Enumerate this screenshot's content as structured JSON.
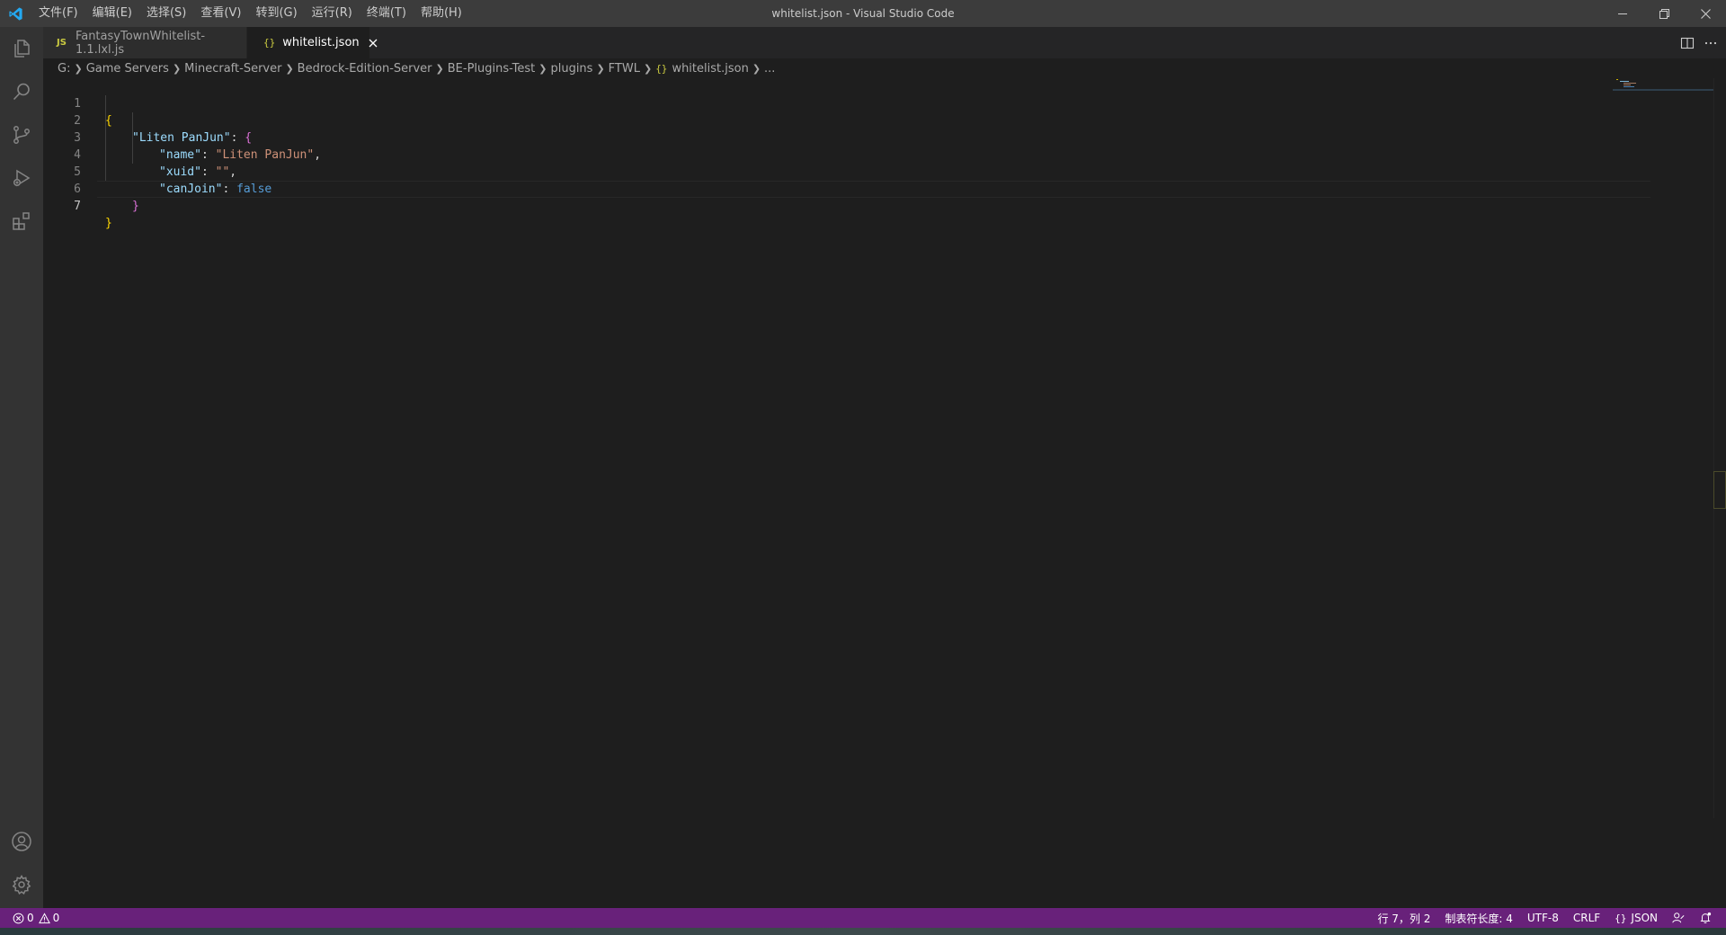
{
  "window": {
    "title": "whitelist.json - Visual Studio Code"
  },
  "menu": [
    "文件(F)",
    "编辑(E)",
    "选择(S)",
    "查看(V)",
    "转到(G)",
    "运行(R)",
    "终端(T)",
    "帮助(H)"
  ],
  "activitybar": {
    "top_icons": [
      "explorer-icon",
      "search-icon",
      "source-control-icon",
      "run-debug-icon",
      "extensions-icon"
    ],
    "bottom_icons": [
      "account-icon",
      "settings-gear-icon"
    ]
  },
  "tabs": [
    {
      "badge": "JS",
      "label": "FantasyTownWhitelist-1.1.lxl.js",
      "active": false
    },
    {
      "badge": "{}",
      "label": "whitelist.json",
      "active": true
    }
  ],
  "breadcrumbs": {
    "items": [
      "G:",
      "Game Servers",
      "Minecraft-Server",
      "Bedrock-Edition-Server",
      "BE-Plugins-Test",
      "plugins",
      "FTWL"
    ],
    "file_icon": "{}",
    "file": "whitelist.json",
    "tail": "..."
  },
  "editor": {
    "line_numbers": [
      "1",
      "2",
      "3",
      "4",
      "5",
      "6",
      "7"
    ],
    "current_line": 7,
    "code": {
      "l1_open": "{",
      "l2_key": "\"Liten PanJun\"",
      "l2_colon": ": ",
      "l2_open": "{",
      "l3_key": "\"name\"",
      "l3_colon": ": ",
      "l3_val": "\"Liten PanJun\"",
      "l3_comma": ",",
      "l4_key": "\"xuid\"",
      "l4_colon": ": ",
      "l4_val": "\"\"",
      "l4_comma": ",",
      "l5_key": "\"canJoin\"",
      "l5_colon": ": ",
      "l5_val": "false",
      "l6_close": "}",
      "l7_close": "}"
    }
  },
  "statusbar": {
    "errors": "0",
    "warnings": "0",
    "position": "行 7，列 2",
    "tab_size": "制表符长度: 4",
    "encoding": "UTF-8",
    "eol": "CRLF",
    "language_icon": "{}",
    "language": "JSON",
    "background": "#68217a"
  },
  "colors": {
    "editor_bg": "#1e1e1e",
    "titlebar_bg": "#3c3c3c",
    "activitybar_bg": "#333333"
  }
}
